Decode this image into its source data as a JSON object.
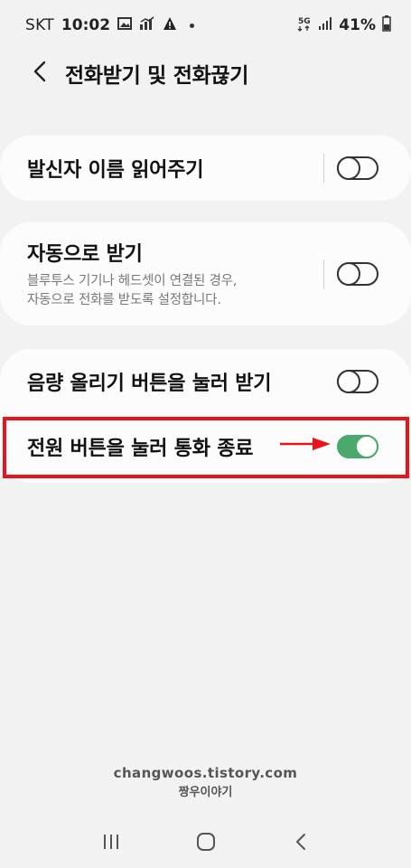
{
  "status_bar": {
    "carrier": "SKT",
    "time": "10:02",
    "network": "5G",
    "battery": "41%",
    "icons": [
      "gallery-icon",
      "signal-chart-icon",
      "warning-icon",
      "dot-icon",
      "5g-icon",
      "cell-signal-icon",
      "battery-icon"
    ]
  },
  "header": {
    "back_icon": "chevron-left-icon",
    "title": "전화받기 및 전화끊기"
  },
  "settings": [
    {
      "title": "발신자 이름 읽어주기",
      "subtitle": "",
      "enabled": false,
      "has_divider": true
    },
    {
      "title": "자동으로 받기",
      "subtitle_line1": "블루투스 기기나 헤드셋이 연결된 경우,",
      "subtitle_line2": "자동으로 전화를 받도록 설정합니다.",
      "enabled": false,
      "has_divider": true
    },
    {
      "title": "음량 올리기 버튼을 눌러 받기",
      "subtitle": "",
      "enabled": false,
      "has_divider": false
    },
    {
      "title": "전원 버튼을 눌러 통화 종료",
      "subtitle": "",
      "enabled": true,
      "has_divider": false
    }
  ],
  "annotation": {
    "highlight_color": "#e8141c",
    "arrow_icon": "red-arrow-icon"
  },
  "watermark": {
    "line1": "changwoos.tistory.com",
    "line2": "짱우이야기"
  },
  "nav_bar": {
    "icons": [
      "recent-apps-icon",
      "home-icon",
      "back-icon"
    ]
  },
  "colors": {
    "background": "#f2f2f2",
    "card": "#fcfcfc",
    "toggle_on": "#4aa96b",
    "subtitle": "#777777"
  }
}
